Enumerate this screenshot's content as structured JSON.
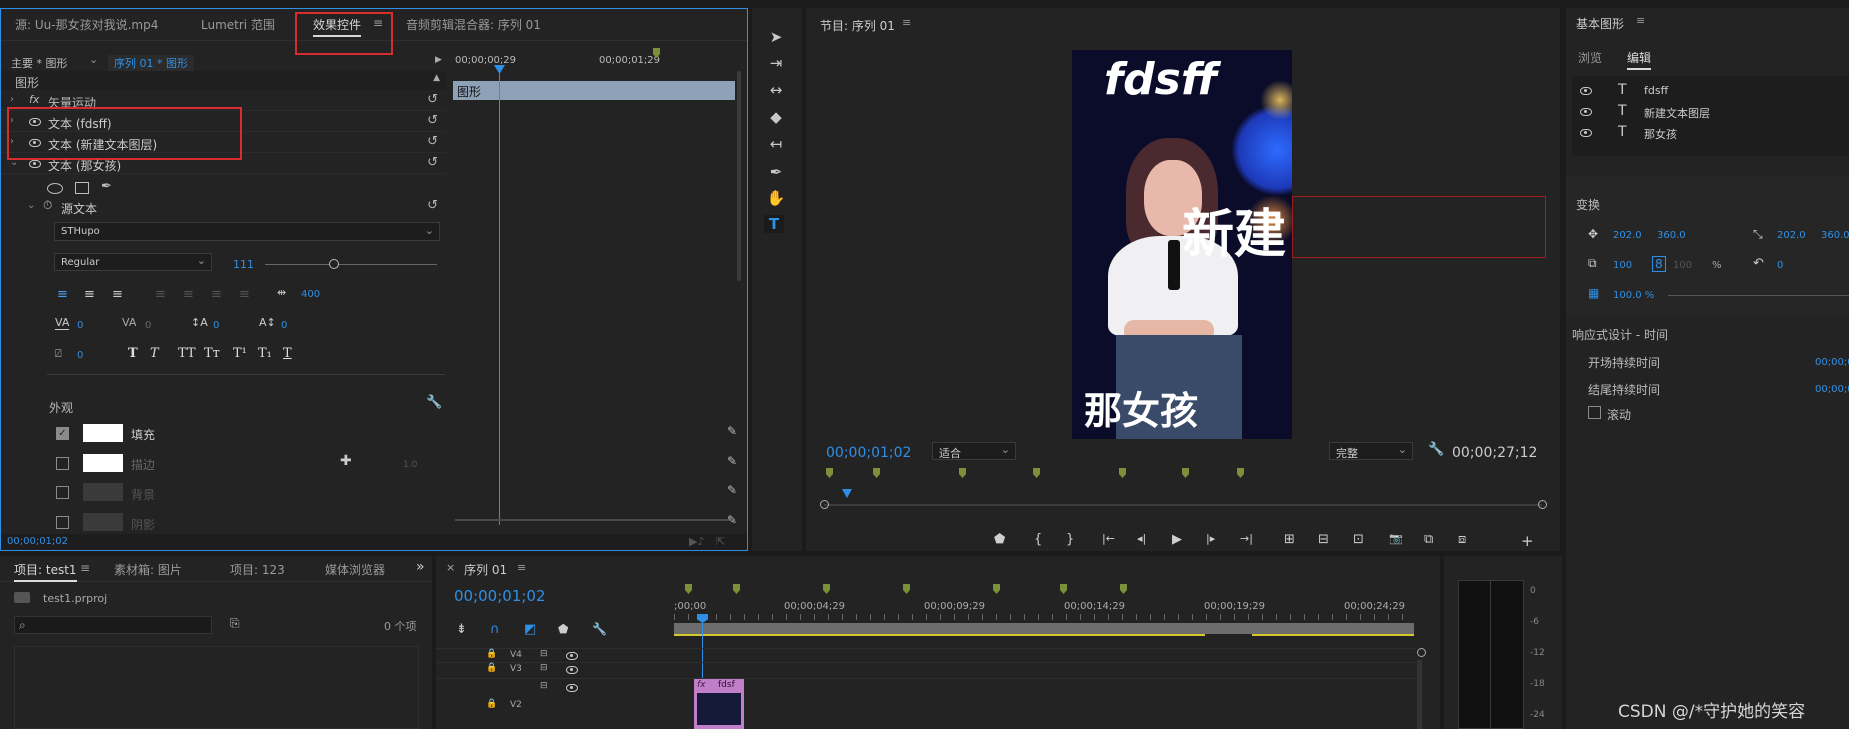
{
  "source_panel": {
    "tabs": [
      {
        "label": "源: Uu-那女孩对我说.mp4"
      },
      {
        "label": "Lumetri 范围"
      },
      {
        "label": "效果控件"
      },
      {
        "label": "音频剪辑混合器: 序列 01"
      }
    ],
    "menu_glyph": "≡",
    "master_label": "主要 * 图形",
    "sequence_label": "序列 01 * 图形",
    "timecode_a": "00;00;00;29",
    "timecode_b": "00;00;01;29",
    "section_label": "图形",
    "clip_label": "图形",
    "rows": {
      "vector_motion": "矢量运动",
      "fx_glyph": "fx",
      "text1": "文本 (fdsff)",
      "text2": "文本 (新建文本图层)",
      "text3": "文本 (那女孩)",
      "source_text": "源文本"
    },
    "font_name": "STHupo",
    "font_style": "Regular",
    "font_size": "111",
    "font_size_pct": 40,
    "tracking_value": "400",
    "kerning_value": "0",
    "tracking2_value": "0",
    "leading_value": "0",
    "baseline_value": "0",
    "tsume_value": "0",
    "type_styles": [
      "T",
      "T",
      "TT",
      "Tт",
      "T¹",
      "T₁",
      "T"
    ],
    "appearance_label": "外观",
    "fill_label": "填充",
    "stroke_label": "描边",
    "stroke_value": "1.0",
    "background_label": "背景",
    "shadow_label": "阴影",
    "status_timecode": "00;00;01;02"
  },
  "program_monitor": {
    "title": "节目: 序列 01",
    "menu_glyph": "≡",
    "overlay_text_top": "fdsff",
    "overlay_text_mid": "新建",
    "overlay_text_bottom": "那女孩",
    "timecode_current": "00;00;01;02",
    "fit_option": "适合",
    "quality_option": "完整",
    "timecode_duration": "00;00;27;12",
    "transport_glyphs": [
      "⬟",
      "{",
      "}",
      "|←",
      "◂|",
      "▶",
      "|▸",
      "→|",
      "⊞",
      "⊟",
      "⊡",
      "📷",
      "⧉",
      "⧈",
      "+"
    ]
  },
  "project_panel": {
    "tabs": [
      {
        "label": "项目: test1"
      },
      {
        "label": "素材箱: 图片"
      },
      {
        "label": "项目: 123"
      },
      {
        "label": "媒体浏览器"
      }
    ],
    "more_glyph": "»",
    "file_name": "test1.prproj",
    "search_placeholder": "",
    "item_count": "0 个项"
  },
  "timeline": {
    "title": "序列 01",
    "close_glyph": "×",
    "menu_glyph": "≡",
    "timecode": "00;00;01;02",
    "ruler_labels": [
      ";00;00",
      "00;00;04;29",
      "00;00;09;29",
      "00;00;14;29",
      "00;00;19;29",
      "00;00;24;29"
    ],
    "tracks": [
      {
        "name": "V4"
      },
      {
        "name": "V3"
      },
      {
        "name": "V2"
      }
    ],
    "clip_label": "fdsf",
    "clip_fx": "fx"
  },
  "essential_graphics": {
    "title": "基本图形",
    "menu_glyph": "≡",
    "tabs": [
      {
        "label": "浏览"
      },
      {
        "label": "编辑"
      }
    ],
    "layers": [
      {
        "label": "fdsff"
      },
      {
        "label": "新建文本图层"
      },
      {
        "label": "那女孩"
      }
    ],
    "transform_label": "变换",
    "position_x": "202.0",
    "position_y": "360.0",
    "anchor_x": "202.0",
    "anchor_y": "360.0",
    "scale_value": "100",
    "scale_value2": "100",
    "percent_sign": "%",
    "rotation_value": "0",
    "opacity_value": "100.0 %",
    "responsive_label": "响应式设计 - 时间",
    "intro_label": "开场持续时间",
    "intro_value": "00;00;0",
    "outro_label": "结尾持续时间",
    "outro_value": "00;00;0",
    "roll_label": "滚动"
  },
  "audio_meter": {
    "scale": [
      "0",
      "-6",
      "-12",
      "-18",
      "-24"
    ]
  },
  "watermark": "CSDN @/*守护她的笑容",
  "colors": {
    "accent_blue": "#2f8fe6",
    "highlight_red": "#d92c2c",
    "marker_green": "#7c8f3a",
    "clip_pink": "#c17fc9",
    "work_area_yellow": "#d6c72a"
  }
}
